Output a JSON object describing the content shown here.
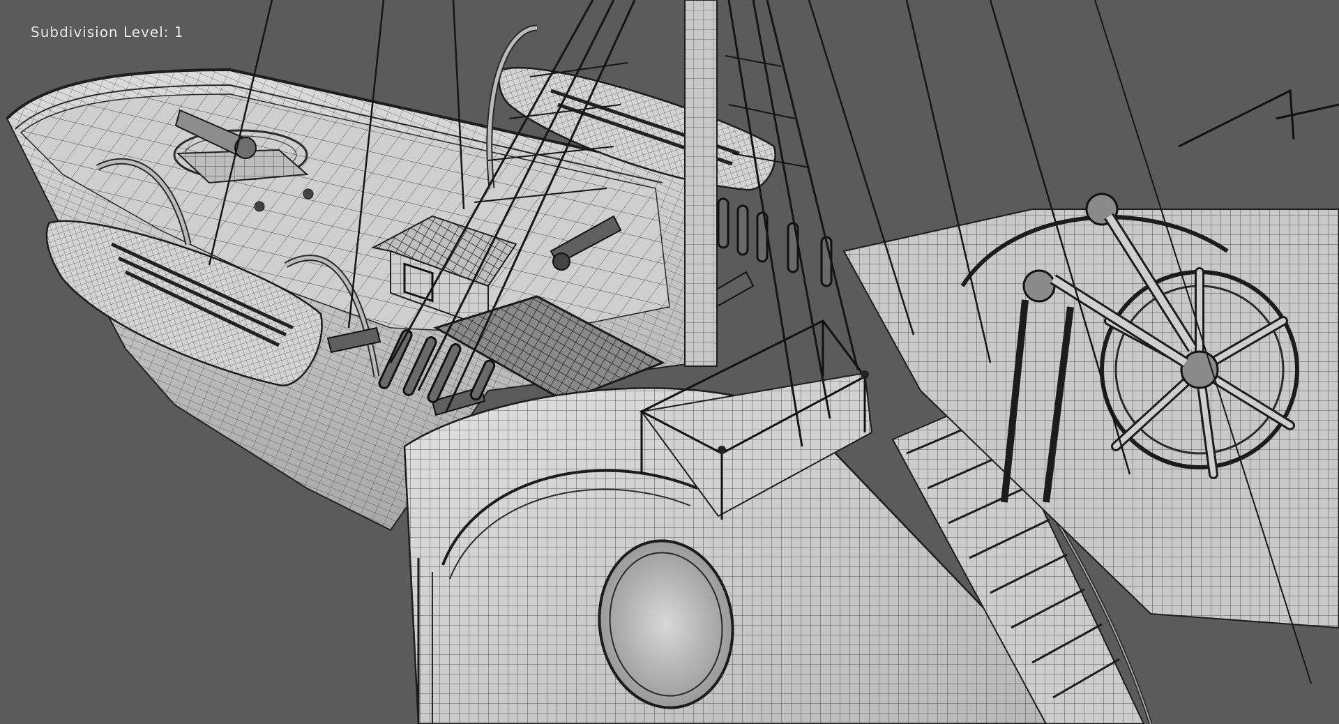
{
  "viewport": {
    "overlay_text": "Subdivision Level: 1",
    "background_color": "#5b5b5b",
    "mesh_fill_color": "#d6d6d6",
    "mesh_shadow_color": "#9d9d9d",
    "wire_color": "#2b2b2b",
    "rope_color": "#1a1a1a"
  }
}
